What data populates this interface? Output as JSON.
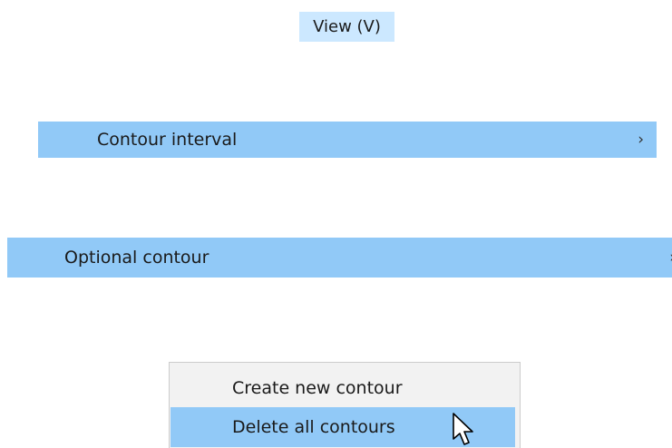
{
  "menubar": {
    "view_label": "View (V)"
  },
  "submenu_items": [
    {
      "label": "Contour interval",
      "arrow": "›"
    },
    {
      "label": "Optional contour",
      "arrow": "›"
    }
  ],
  "context_menu": {
    "items": [
      {
        "label": "Create new contour",
        "highlighted": false
      },
      {
        "label": "Delete all contours",
        "highlighted": true
      }
    ]
  },
  "colors": {
    "highlight": "#91c9f7",
    "menubar_highlight": "#cce8ff",
    "menu_background": "#f2f2f2"
  },
  "icons": {
    "cursor": "mouse-pointer-icon",
    "submenu": "chevron-right-icon"
  }
}
